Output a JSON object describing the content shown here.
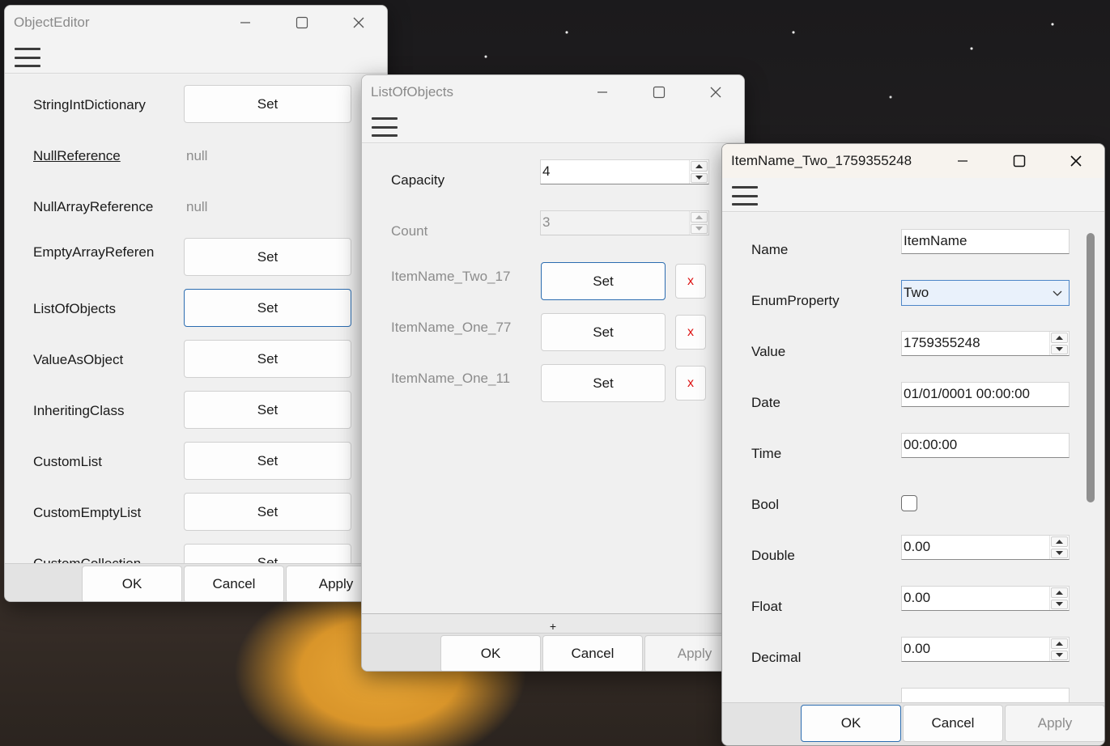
{
  "windows": {
    "object_editor": {
      "title": "ObjectEditor",
      "rows": [
        {
          "label": "StringIntDictionary",
          "kind": "button",
          "value": "Set"
        },
        {
          "label": "NullReference",
          "kind": "null",
          "value": "null"
        },
        {
          "label": "NullArrayReference",
          "kind": "null",
          "value": "null"
        },
        {
          "label": "EmptyArrayReferen",
          "kind": "button",
          "value": "Set"
        },
        {
          "label": "ListOfObjects",
          "kind": "button",
          "value": "Set"
        },
        {
          "label": "ValueAsObject",
          "kind": "button",
          "value": "Set"
        },
        {
          "label": "InheritingClass",
          "kind": "button",
          "value": "Set"
        },
        {
          "label": "CustomList",
          "kind": "button",
          "value": "Set"
        },
        {
          "label": "CustomEmptyList",
          "kind": "button",
          "value": "Set"
        },
        {
          "label": "CustomCollection",
          "kind": "button",
          "value": "Set"
        }
      ],
      "footer": {
        "ok": "OK",
        "cancel": "Cancel",
        "apply": "Apply"
      }
    },
    "list_of_objects": {
      "title": "ListOfObjects",
      "capacity_label": "Capacity",
      "capacity_value": "4",
      "count_label": "Count",
      "count_value": "3",
      "items": [
        {
          "label": "ItemName_Two_17",
          "set": "Set",
          "remove": "x"
        },
        {
          "label": "ItemName_One_77",
          "set": "Set",
          "remove": "x"
        },
        {
          "label": "ItemName_One_11",
          "set": "Set",
          "remove": "x"
        }
      ],
      "add_glyph": "+",
      "footer": {
        "ok": "OK",
        "cancel": "Cancel",
        "apply": "Apply"
      }
    },
    "item_editor": {
      "title": "ItemName_Two_1759355248",
      "fields": {
        "name": {
          "label": "Name",
          "value": "ItemName"
        },
        "enum": {
          "label": "EnumProperty",
          "value": "Two"
        },
        "value": {
          "label": "Value",
          "value": "1759355248"
        },
        "date": {
          "label": "Date",
          "value": "01/01/0001 00:00:00"
        },
        "time": {
          "label": "Time",
          "value": "00:00:00"
        },
        "bool": {
          "label": "Bool",
          "checked": false
        },
        "double": {
          "label": "Double",
          "value": "0.00"
        },
        "float": {
          "label": "Float",
          "value": "0.00"
        },
        "decimal": {
          "label": "Decimal",
          "value": "0.00"
        }
      },
      "footer": {
        "ok": "OK",
        "cancel": "Cancel",
        "apply": "Apply"
      }
    }
  },
  "icons": [
    "minimize-icon",
    "maximize-icon",
    "close-icon",
    "hamburger-menu-icon",
    "spin-up-icon",
    "spin-down-icon",
    "chevron-down-icon"
  ]
}
